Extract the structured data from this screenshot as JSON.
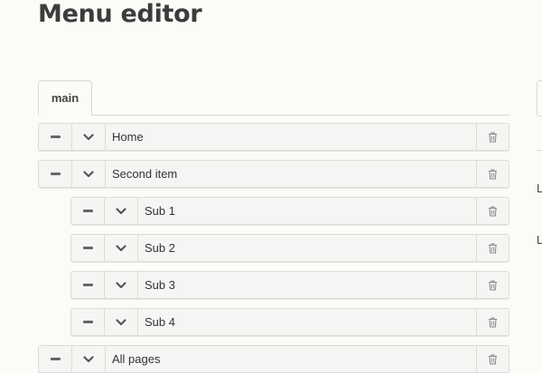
{
  "page": {
    "title": "Menu editor"
  },
  "tabs": [
    {
      "label": "main",
      "active": true
    }
  ],
  "menu_items": [
    {
      "label": "Home",
      "level": 0
    },
    {
      "label": "Second item",
      "level": 0
    },
    {
      "label": "Sub 1",
      "level": 1
    },
    {
      "label": "Sub 2",
      "level": 1
    },
    {
      "label": "Sub 3",
      "level": 1
    },
    {
      "label": "Sub 4",
      "level": 1
    },
    {
      "label": "All pages",
      "level": 0
    }
  ],
  "right_panel": {
    "fragments": [
      "L",
      "L"
    ]
  },
  "colors": {
    "background": "#fbfbf8",
    "row_bg": "#f5f5f3",
    "border": "#dcdcd8"
  }
}
